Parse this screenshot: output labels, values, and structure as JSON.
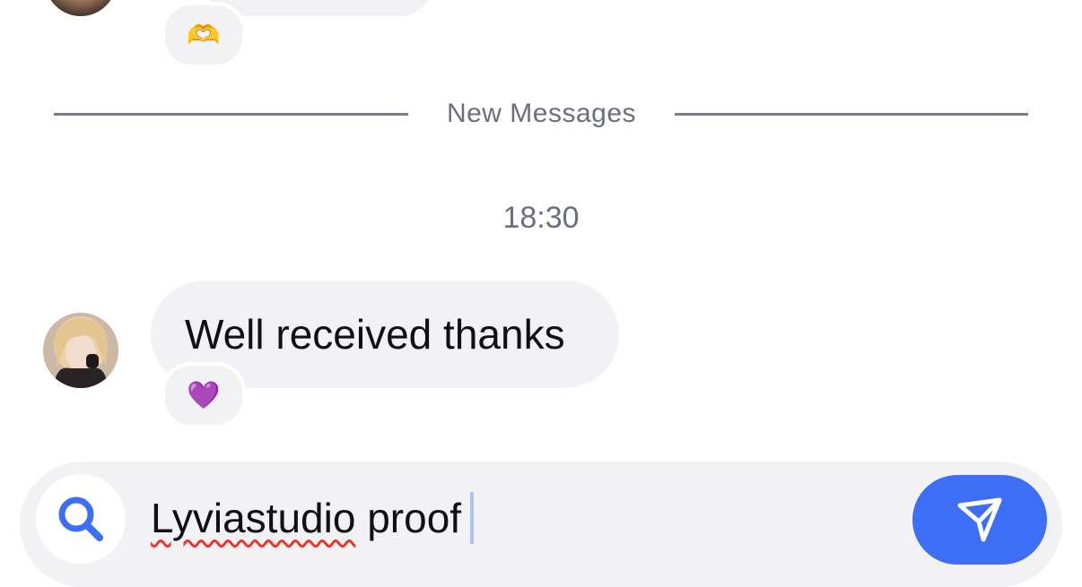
{
  "chat": {
    "divider_label": "New Messages",
    "timestamp": "18:30",
    "top_message": {
      "reaction": "🫶"
    },
    "message": {
      "text": "Well received thanks",
      "reaction": "💜"
    }
  },
  "composer": {
    "input_value_typo": "Lyviastudio",
    "input_value_rest": " proof",
    "search_icon": "search-icon",
    "send_icon": "send-icon"
  },
  "colors": {
    "accent": "#3c6ff5",
    "bubble": "#f2f2f5",
    "muted_text": "#6b6f7b",
    "spellcheck": "#e5372f"
  }
}
